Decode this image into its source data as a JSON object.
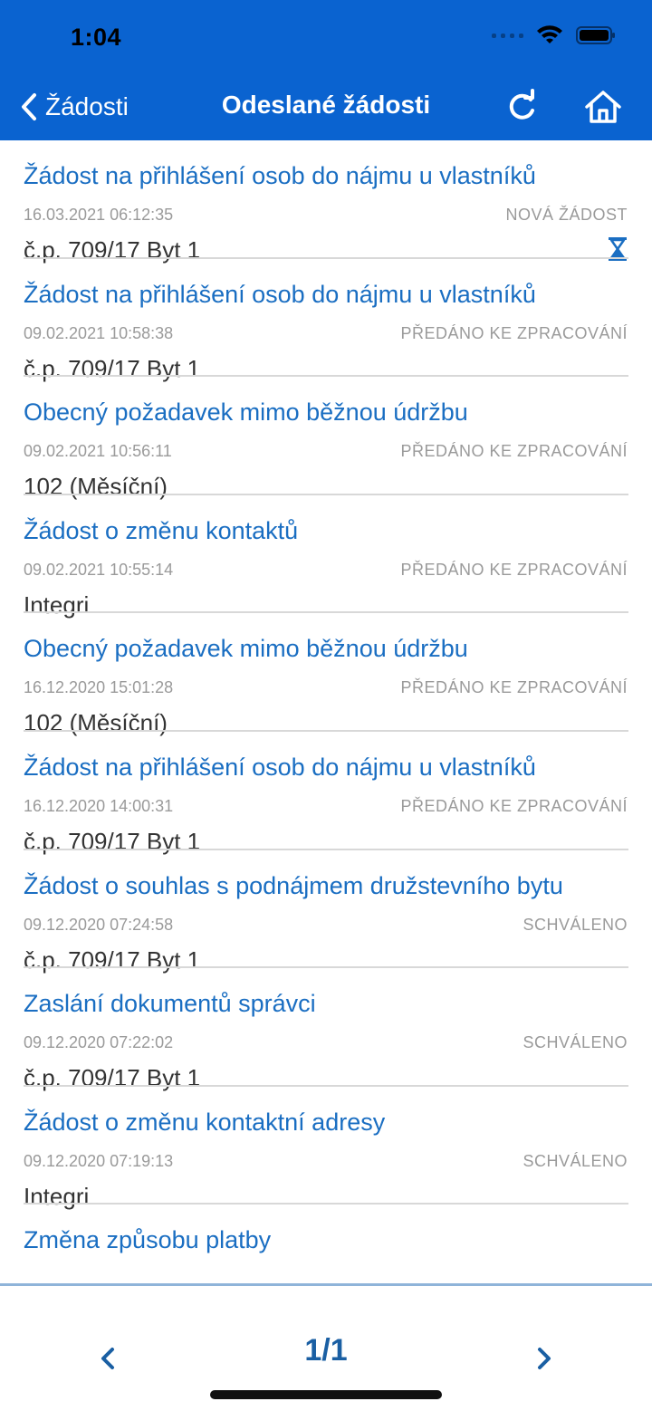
{
  "status_bar": {
    "time": "1:04"
  },
  "nav": {
    "back_label": "Žádosti",
    "title": "Odeslané žádosti",
    "bar_color": "#0a63d0"
  },
  "requests": [
    {
      "title": "Žádost na přihlášení osob do nájmu u vlastníků",
      "date": "16.03.2021 06:12:35",
      "status": "NOVÁ ŽÁDOST",
      "subject": "č.p. 709/17 Byt 1",
      "icon": "hourglass-icon"
    },
    {
      "title": "Žádost na přihlášení osob do nájmu u vlastníků",
      "date": "09.02.2021 10:58:38",
      "status": "PŘEDÁNO KE ZPRACOVÁNÍ",
      "subject": "č.p. 709/17 Byt 1"
    },
    {
      "title": "Obecný požadavek mimo běžnou údržbu",
      "date": "09.02.2021 10:56:11",
      "status": "PŘEDÁNO KE ZPRACOVÁNÍ",
      "subject": "102 (Měsíční)"
    },
    {
      "title": "Žádost o změnu kontaktů",
      "date": "09.02.2021 10:55:14",
      "status": "PŘEDÁNO KE ZPRACOVÁNÍ",
      "subject": "Integri"
    },
    {
      "title": "Obecný požadavek mimo běžnou údržbu",
      "date": "16.12.2020 15:01:28",
      "status": "PŘEDÁNO KE ZPRACOVÁNÍ",
      "subject": "102 (Měsíční)"
    },
    {
      "title": "Žádost na přihlášení osob do nájmu u vlastníků",
      "date": "16.12.2020 14:00:31",
      "status": "PŘEDÁNO KE ZPRACOVÁNÍ",
      "subject": "č.p. 709/17 Byt 1"
    },
    {
      "title": "Žádost o souhlas s podnájmem družstevního bytu",
      "date": "09.12.2020 07:24:58",
      "status": "SCHVÁLENO",
      "subject": "č.p. 709/17 Byt 1"
    },
    {
      "title": "Zaslání dokumentů správci",
      "date": "09.12.2020 07:22:02",
      "status": "SCHVÁLENO",
      "subject": "č.p. 709/17 Byt 1"
    },
    {
      "title": "Žádost o změnu kontaktní adresy",
      "date": "09.12.2020 07:19:13",
      "status": "SCHVÁLENO",
      "subject": "Integri"
    },
    {
      "title": "Změna způsobu platby",
      "date": "",
      "status": "",
      "subject": ""
    }
  ],
  "pager": {
    "label": "1/1"
  },
  "colors": {
    "title_link": "#1a6ec2",
    "meta": "#9a9a9a",
    "pager": "#1a5fa3"
  }
}
